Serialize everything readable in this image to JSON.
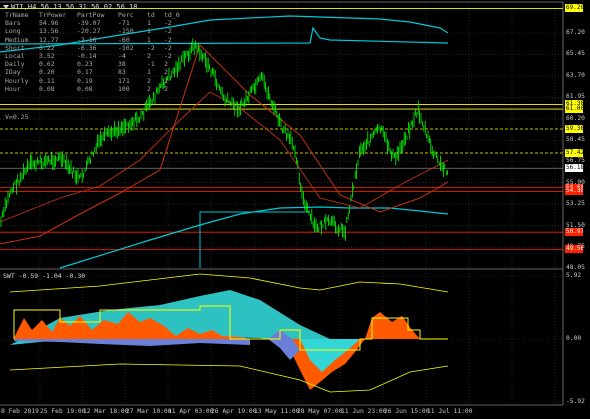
{
  "header": {
    "symbol_tf": "WTI,H4",
    "ohlc": "56.13 56.31 56.02 56.18"
  },
  "stats_table": {
    "columns": [
      "TrName",
      "TrPower",
      "PartPow",
      "Perc",
      "td",
      "td_0"
    ],
    "rows": [
      [
        "Bars",
        "54.96",
        "-39.07",
        "-71",
        "1",
        "-2"
      ],
      [
        "Long",
        "13.56",
        "-20.27",
        "-150",
        "1",
        "-2"
      ],
      [
        "Medium",
        "12.77",
        "-2.16",
        "-60",
        "1",
        "-2"
      ],
      [
        "Short",
        "6.22",
        "-6.36",
        "-102",
        "-2",
        "-2"
      ],
      [
        "Local",
        "3.52",
        "-0.14",
        "-4",
        "2",
        "-2"
      ],
      [
        "Daily",
        "0.62",
        "0.23",
        "38",
        "-1",
        "2"
      ],
      [
        "IDay",
        "0.20",
        "0.17",
        "83",
        "1",
        "2"
      ],
      [
        "Hourly",
        "0.11",
        "0.19",
        "171",
        "2",
        "2"
      ],
      [
        "Hour",
        "0.08",
        "0.08",
        "100",
        "2",
        "2"
      ]
    ],
    "extra": "V=0.25"
  },
  "sub_header": "SWT -0.59 -1.04 -0.30",
  "price_axis": [
    "67.20",
    "65.45",
    "63.70",
    "61.95",
    "60.20",
    "58.45",
    "56.75",
    "55.00",
    "53.25",
    "51.50",
    "49.75",
    "48.05"
  ],
  "sub_axis": [
    "5.92",
    "0.00",
    "-5.92"
  ],
  "price_tags": [
    {
      "label": "69.20",
      "color": "#ffff00",
      "text": "#000000",
      "y": 69.2
    },
    {
      "label": "61.38",
      "color": "#ffff00",
      "text": "#000000",
      "y": 61.38
    },
    {
      "label": "61.00",
      "color": "#ffff00",
      "text": "#000000",
      "y": 61.0
    },
    {
      "label": "59.38",
      "color": "#ffff00",
      "text": "#000000",
      "y": 59.38
    },
    {
      "label": "57.42",
      "color": "#ffff00",
      "text": "#000000",
      "y": 57.42
    },
    {
      "label": "56.18",
      "color": "#ffffff",
      "text": "#000000",
      "y": 56.18
    },
    {
      "label": "54.60",
      "color": "#ff2200",
      "text": "#ffffff",
      "y": 54.6
    },
    {
      "label": "54.30",
      "color": "#ff2200",
      "text": "#ffffff",
      "y": 54.3
    },
    {
      "label": "50.97",
      "color": "#ff2200",
      "text": "#ffffff",
      "y": 50.97
    },
    {
      "label": "49.56",
      "color": "#ff2200",
      "text": "#ffffff",
      "y": 49.56
    }
  ],
  "time_axis": [
    "8 Feb 2019",
    "25 Feb 19:00",
    "12 Mar 18:00",
    "27 Mar 10:00",
    "11 Apr 03:00",
    "26 Apr 19:00",
    "13 May 11:00",
    "28 May 07:00",
    "11 Jun 23:00",
    "26 Jun 15:00",
    "11 Jul 11:00"
  ],
  "colors": {
    "background": "#000000",
    "grid": "#3a3a3a",
    "candles": "#00ff00",
    "cyan_band": "#00c8d8",
    "red_line": "#c83010",
    "yellow_level": "#ffff00",
    "red_level": "#ff2200",
    "osc_orange": "#ff5a00",
    "osc_cyan": "#33d6d6",
    "osc_blue": "#6a7fd8",
    "osc_yellow": "#ffff00"
  }
}
